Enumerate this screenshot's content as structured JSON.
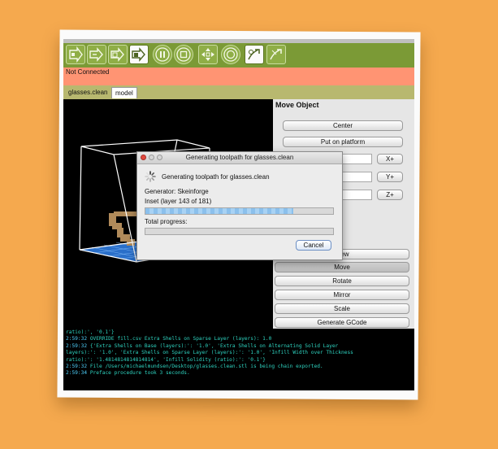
{
  "status": {
    "text": "Not Connected"
  },
  "tabs": [
    {
      "label": "glasses.clean"
    },
    {
      "label": "model"
    }
  ],
  "toolbar": {
    "icons": [
      "build-icon",
      "upload-icon",
      "build-to-file-icon",
      "build-from-file-icon",
      "pause-icon",
      "stop-icon",
      "jog-icon",
      "temperature-icon",
      "reset-icon",
      "disconnect-icon"
    ]
  },
  "move_panel": {
    "title": "Move Object",
    "center_label": "Center",
    "put_on_platform_label": "Put on platform",
    "x_plus": "X+",
    "y_plus": "Y+",
    "z_plus": "Z+"
  },
  "mode_buttons": {
    "view": "View",
    "move": "Move",
    "rotate": "Rotate",
    "mirror": "Mirror",
    "scale": "Scale",
    "generate": "Generate GCode"
  },
  "dialog": {
    "title": "Generating toolpath for glasses.clean",
    "heading": "Generating toolpath for glasses.clean",
    "generator": "Generator: Skeinforge",
    "stage": "Inset (layer 143 of 181)",
    "stage_progress": 0.79,
    "total_label": "Total progress:",
    "total_progress": 0,
    "cancel_label": "Cancel"
  },
  "console": {
    "lines": [
      {
        "ts": "",
        "text": "ratio):', '0.1'}"
      },
      {
        "ts": "2:59:32",
        "text": "OVERRIDE fill.csv Extra Shells on Sparse Layer (layers): 1.0"
      },
      {
        "ts": "2:59:32",
        "text": "{'Extra Shells on Base (layers):': '1.0', 'Extra Shells on Alternating Solid Layer"
      },
      {
        "ts": "",
        "text": "layers):': '1.0', 'Extra Shells on Sparse Layer (layers):': '1.0', 'Infill Width over Thickness"
      },
      {
        "ts": "",
        "text": "ratio):': '1.4814814814814814', 'Infill Solidity (ratio):': '0.1'}"
      },
      {
        "ts": "2:59:32",
        "text": "File /Users/michaelmundsen/Desktop/glasses.clean.stl is being chain exported."
      },
      {
        "ts": "2:59:34",
        "text": "Preface procedure took 3 seconds."
      }
    ]
  }
}
